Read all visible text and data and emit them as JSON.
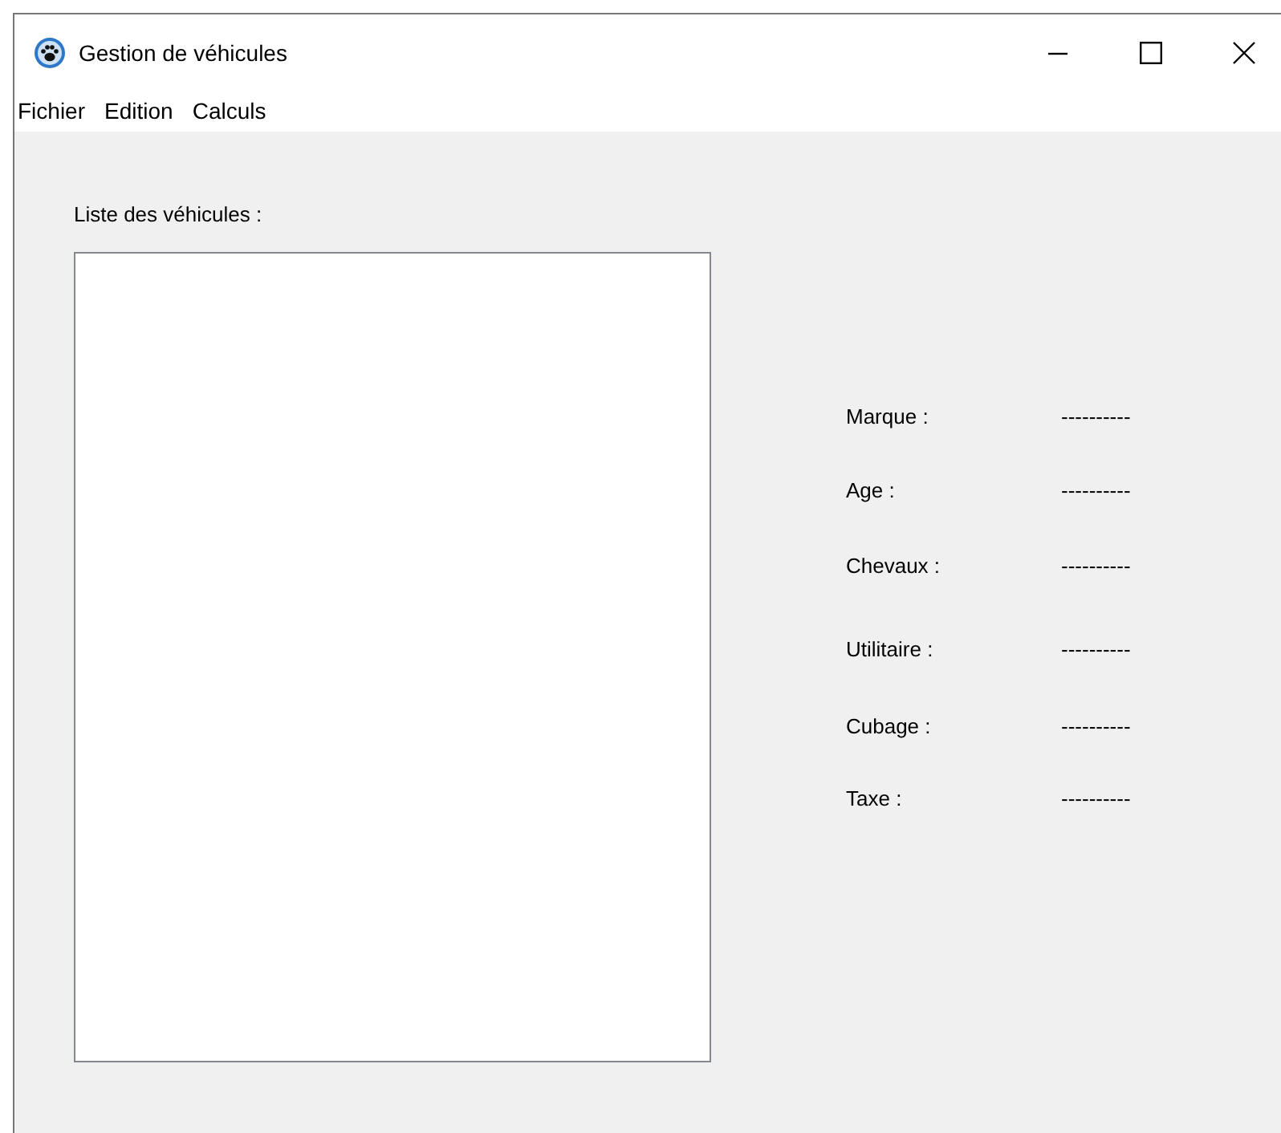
{
  "window": {
    "title": "Gestion de véhicules"
  },
  "menu": [
    "Fichier",
    "Edition",
    "Calculs"
  ],
  "list": {
    "label": "Liste des véhicules :"
  },
  "fields": [
    {
      "label": "Marque :",
      "value": "----------"
    },
    {
      "label": "Age :",
      "value": "----------"
    },
    {
      "label": "Chevaux :",
      "value": "----------"
    },
    {
      "label": "Utilitaire :",
      "value": "----------"
    },
    {
      "label": "Cubage :",
      "value": "----------"
    },
    {
      "label": "Taxe :",
      "value": "----------"
    }
  ]
}
